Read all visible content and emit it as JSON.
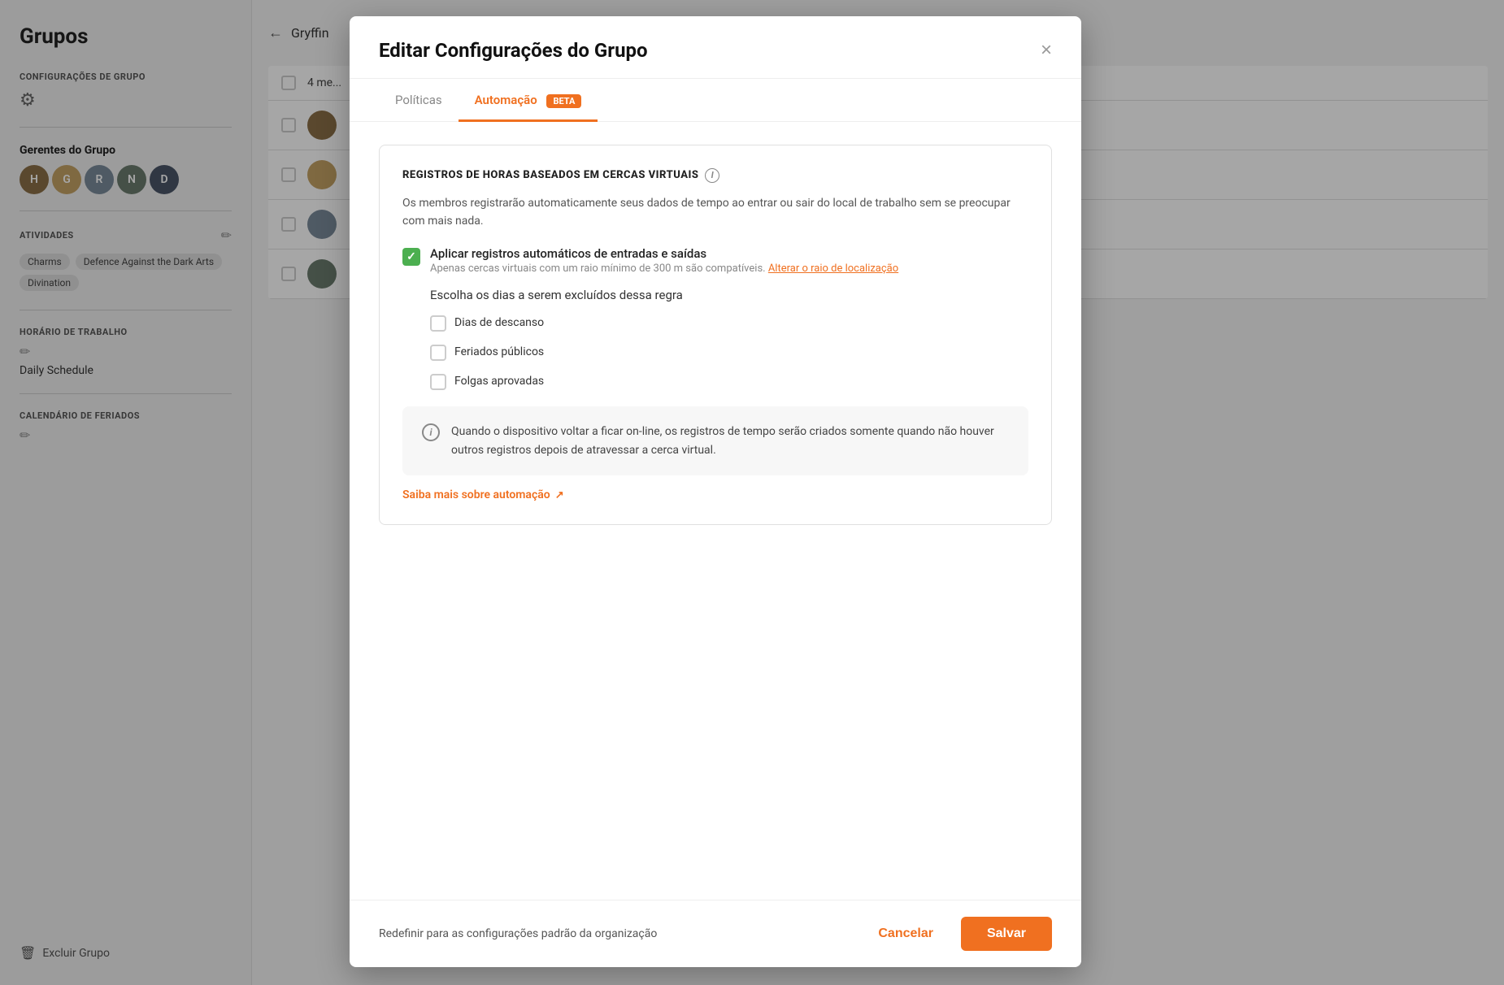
{
  "sidebar": {
    "title": "Grupos",
    "sections": {
      "config_label": "CONFIGURAÇÕES DE GRUPO",
      "managers_label": "Gerentes do Grupo",
      "activities_label": "ATIVIDADES",
      "activities": [
        "Charms",
        "Defence Against the Dark Arts",
        "Divination"
      ],
      "schedule_label": "HORÁRIO DE TRABALHO",
      "schedule_name": "Daily Schedule",
      "calendar_label": "CALENDÁRIO DE FERIADOS",
      "delete_label": "Excluir Grupo"
    }
  },
  "main": {
    "back_text": "Gryffin"
  },
  "modal": {
    "title": "Editar Configurações do Grupo",
    "close_label": "×",
    "tabs": [
      {
        "label": "Políticas",
        "active": false
      },
      {
        "label": "Automação",
        "active": true
      },
      {
        "beta_label": "BETA"
      }
    ],
    "card": {
      "title": "REGISTROS DE HORAS BASEADOS EM CERCAS VIRTUAIS",
      "description": "Os membros registrarão automaticamente seus dados de tempo ao entrar ou sair do local de trabalho sem se preocupar com mais nada.",
      "checkbox_main_label": "Aplicar registros automáticos de entradas e saídas",
      "checkbox_main_sub": "Apenas cercas virtuais com um raio mínimo de 300 m são compatíveis.",
      "link_text": "Alterar o raio de localização",
      "days_title": "Escolha os dias a serem excluídos dessa regra",
      "day_options": [
        {
          "label": "Dias de descanso"
        },
        {
          "label": "Feriados públicos"
        },
        {
          "label": "Folgas aprovadas"
        }
      ],
      "info_text": "Quando o dispositivo voltar a ficar on-line, os registros de tempo serão criados somente quando não houver outros registros depois de atravessar a cerca virtual.",
      "learn_more_text": "Saiba mais sobre automação"
    },
    "footer": {
      "reset_text": "Redefinir para as configurações padrão da organização",
      "cancel_label": "Cancelar",
      "save_label": "Salvar"
    }
  }
}
